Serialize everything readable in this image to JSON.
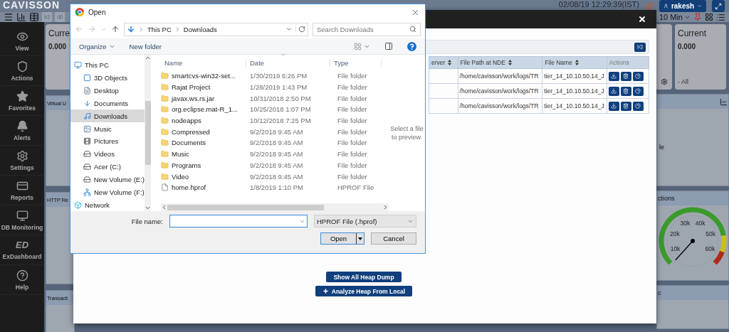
{
  "app": {
    "logo": "CAVISSON",
    "datetime": "02/08/19 12:29:39(IST)",
    "user": "rakesh",
    "time_range": "10 Min",
    "sidebar": [
      {
        "label": "View"
      },
      {
        "label": "Actions"
      },
      {
        "label": "Favorites"
      },
      {
        "label": "Alerts"
      },
      {
        "label": "Settings"
      },
      {
        "label": "Reports"
      },
      {
        "label": "DB Monitoring"
      },
      {
        "label": "ExDashboard",
        "badge": "ED"
      },
      {
        "label": "Help"
      }
    ],
    "left_column": {
      "card_title": "Curre",
      "card_value": "0.000",
      "panels": [
        "Virtual U",
        "HTTP Re",
        "Transacti"
      ]
    },
    "right_column": {
      "card_title": "Current",
      "card_value": "0.000",
      "card_note": "- All",
      "panel_text": "le",
      "gauge_title": "ctions",
      "gauge_ticks": [
        "10k",
        "20k",
        "30k",
        "40k",
        "50k",
        "60k"
      ],
      "last_panel_title": "c"
    }
  },
  "modal": {
    "table": {
      "columns": [
        "erver",
        "File Path at NDE",
        "File Name",
        "Actions"
      ],
      "rows": [
        {
          "file_path": "/home/cavisson/work/logs/TR",
          "file_name": "tier_14_10.10.50.14_J"
        },
        {
          "file_path": "/home/cavisson/work/logs/TR",
          "file_name": "tier_14_10.10.50.14_J"
        },
        {
          "file_path": "/home/cavisson/work/logs/TR",
          "file_name": "tier_14_10.10.50.14_J"
        }
      ]
    },
    "buttons": [
      {
        "label": "Show All Heap Dump",
        "kind": "plain"
      },
      {
        "label": "Analyze Heap From Local",
        "kind": "add"
      }
    ]
  },
  "dialog": {
    "title": "Open",
    "path": [
      "This PC",
      "Downloads"
    ],
    "search": {
      "placeholder": "Search Downloads"
    },
    "organize": "Organize",
    "new_folder": "New folder",
    "nav": [
      {
        "label": "This PC",
        "selected": false,
        "children": [
          {
            "label": "3D Objects",
            "selected": false
          },
          {
            "label": "Desktop",
            "selected": false
          },
          {
            "label": "Documents",
            "selected": false
          },
          {
            "label": "Downloads",
            "selected": true
          },
          {
            "label": "Music",
            "selected": false
          },
          {
            "label": "Pictures",
            "selected": false
          },
          {
            "label": "Videos",
            "selected": false
          },
          {
            "label": "Acer (C:)",
            "selected": false
          },
          {
            "label": "New Volume (E:)",
            "selected": false
          },
          {
            "label": "New Volume (F:)",
            "selected": false
          }
        ]
      },
      {
        "label": "Network",
        "selected": false
      }
    ],
    "columns": [
      "Name",
      "Date",
      "Type"
    ],
    "files": [
      {
        "name": "smartcvs-win32-set...",
        "date": "1/30/2019 6:26 PM",
        "type": "File folder",
        "kind": "folder"
      },
      {
        "name": "Rajat Project",
        "date": "1/28/2019 1:43 PM",
        "type": "File folder",
        "kind": "folder"
      },
      {
        "name": "javax.ws.rs.jar",
        "date": "10/31/2018 2:50 PM",
        "type": "File folder",
        "kind": "folder"
      },
      {
        "name": "org.eclipse.mat-R_1...",
        "date": "10/25/2018 1:07 PM",
        "type": "File folder",
        "kind": "folder"
      },
      {
        "name": "nodeapps",
        "date": "10/12/2018 7:25 PM",
        "type": "File folder",
        "kind": "folder"
      },
      {
        "name": "Compressed",
        "date": "9/2/2018 9:45 AM",
        "type": "File folder",
        "kind": "folder"
      },
      {
        "name": "Documents",
        "date": "9/2/2018 9:45 AM",
        "type": "File folder",
        "kind": "folder"
      },
      {
        "name": "Music",
        "date": "9/2/2018 9:45 AM",
        "type": "File folder",
        "kind": "folder"
      },
      {
        "name": "Programs",
        "date": "9/2/2018 9:45 AM",
        "type": "File folder",
        "kind": "folder"
      },
      {
        "name": "Video",
        "date": "9/2/2018 9:45 AM",
        "type": "File folder",
        "kind": "folder"
      },
      {
        "name": "home.hprof",
        "date": "1/8/2019 1:10 PM",
        "type": "HPROF File",
        "kind": "file"
      }
    ],
    "preview": "Select a file to preview.",
    "file_name_label": "File name:",
    "filter": "HPROF File (.hprof)",
    "open": "Open",
    "cancel": "Cancel"
  }
}
